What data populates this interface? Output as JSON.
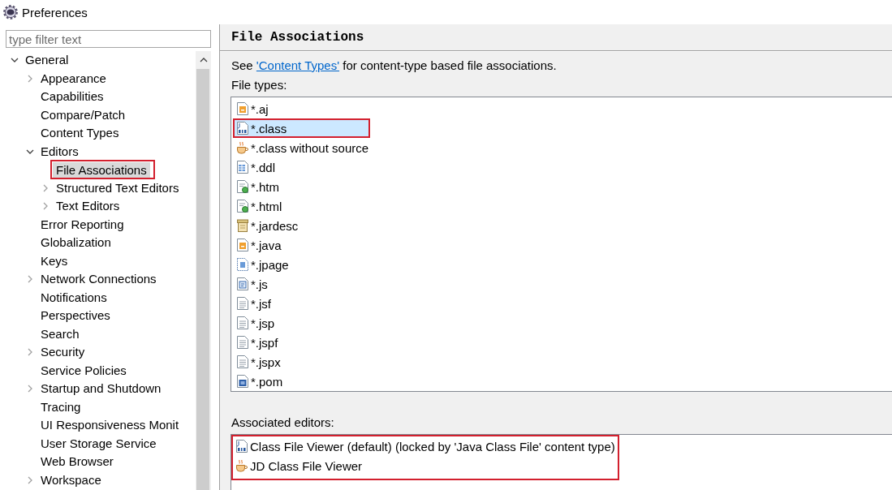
{
  "window": {
    "title": "Preferences"
  },
  "sidebar": {
    "filter": {
      "placeholder": "type filter text"
    },
    "tree": [
      {
        "label": "General",
        "expanded": true,
        "selected": false,
        "outlined": false,
        "children": [
          {
            "label": "Appearance",
            "expanded": false,
            "selected": false,
            "outlined": false
          },
          {
            "label": "Capabilities",
            "selected": false,
            "outlined": false
          },
          {
            "label": "Compare/Patch",
            "selected": false,
            "outlined": false
          },
          {
            "label": "Content Types",
            "selected": false,
            "outlined": false
          },
          {
            "label": "Editors",
            "expanded": true,
            "selected": false,
            "outlined": false,
            "children": [
              {
                "label": "File Associations",
                "selected": true,
                "outlined": true
              },
              {
                "label": "Structured Text Editors",
                "expanded": false,
                "selected": false,
                "outlined": false
              },
              {
                "label": "Text Editors",
                "expanded": false,
                "selected": false,
                "outlined": false
              }
            ]
          },
          {
            "label": "Error Reporting",
            "selected": false,
            "outlined": false
          },
          {
            "label": "Globalization",
            "selected": false,
            "outlined": false
          },
          {
            "label": "Keys",
            "selected": false,
            "outlined": false
          },
          {
            "label": "Network Connections",
            "expanded": false,
            "selected": false,
            "outlined": false
          },
          {
            "label": "Notifications",
            "selected": false,
            "outlined": false
          },
          {
            "label": "Perspectives",
            "selected": false,
            "outlined": false
          },
          {
            "label": "Search",
            "selected": false,
            "outlined": false
          },
          {
            "label": "Security",
            "expanded": false,
            "selected": false,
            "outlined": false
          },
          {
            "label": "Service Policies",
            "selected": false,
            "outlined": false
          },
          {
            "label": "Startup and Shutdown",
            "expanded": false,
            "selected": false,
            "outlined": false
          },
          {
            "label": "Tracing",
            "selected": false,
            "outlined": false
          },
          {
            "label": "UI Responsiveness Monit",
            "selected": false,
            "outlined": false
          },
          {
            "label": "User Storage Service",
            "selected": false,
            "outlined": false
          },
          {
            "label": "Web Browser",
            "selected": false,
            "outlined": false
          },
          {
            "label": "Workspace",
            "expanded": false,
            "selected": false,
            "outlined": false
          }
        ]
      }
    ]
  },
  "page": {
    "title": "File Associations",
    "intro": {
      "prefix": "See",
      "link": "'Content Types'",
      "suffix": "for content-type based file associations."
    },
    "file_types": {
      "label": "File types:",
      "items": [
        {
          "name": "*.aj",
          "kind": "source",
          "selected": false,
          "outlined": false
        },
        {
          "name": "*.class",
          "kind": "binary",
          "selected": true,
          "outlined": true
        },
        {
          "name": "*.class without source",
          "kind": "cup",
          "selected": false,
          "outlined": false
        },
        {
          "name": "*.ddl",
          "kind": "table",
          "selected": false,
          "outlined": false
        },
        {
          "name": "*.htm",
          "kind": "web",
          "selected": false,
          "outlined": false
        },
        {
          "name": "*.html",
          "kind": "web",
          "selected": false,
          "outlined": false
        },
        {
          "name": "*.jardesc",
          "kind": "jar",
          "selected": false,
          "outlined": false
        },
        {
          "name": "*.java",
          "kind": "source",
          "selected": false,
          "outlined": false
        },
        {
          "name": "*.jpage",
          "kind": "scrapbook",
          "selected": false,
          "outlined": false
        },
        {
          "name": "*.js",
          "kind": "script",
          "selected": false,
          "outlined": false
        },
        {
          "name": "*.jsf",
          "kind": "text",
          "selected": false,
          "outlined": false
        },
        {
          "name": "*.jsp",
          "kind": "text",
          "selected": false,
          "outlined": false
        },
        {
          "name": "*.jspf",
          "kind": "text",
          "selected": false,
          "outlined": false
        },
        {
          "name": "*.jspx",
          "kind": "text",
          "selected": false,
          "outlined": false
        },
        {
          "name": "*.pom",
          "kind": "maven",
          "selected": false,
          "outlined": false
        }
      ]
    },
    "associated_editors": {
      "label": "Associated editors:",
      "outlined": true,
      "items": [
        {
          "name": "Class File Viewer (default) (locked by 'Java Class File' content type)",
          "kind": "binary",
          "selected": false
        },
        {
          "name": "JD Class File Viewer",
          "kind": "cup",
          "selected": false
        }
      ]
    }
  }
}
